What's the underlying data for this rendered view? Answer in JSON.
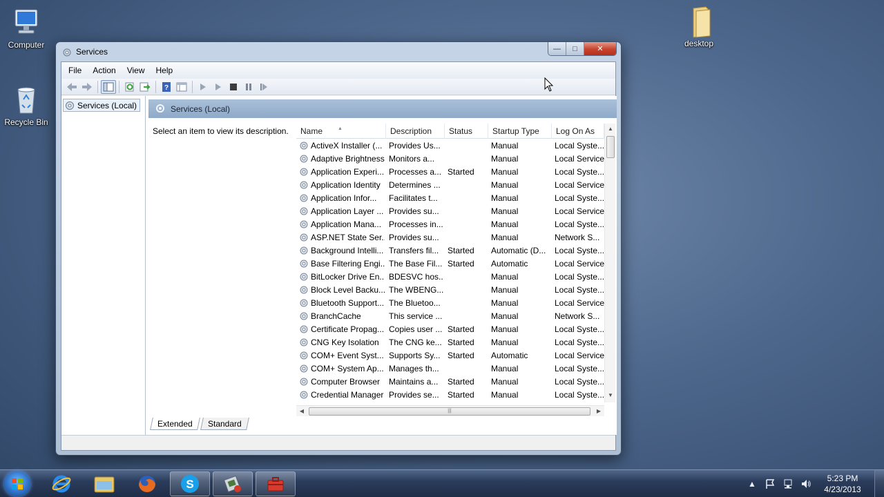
{
  "desktop": {
    "icons": [
      {
        "label": "Computer"
      },
      {
        "label": "Recycle Bin"
      },
      {
        "label": "desktop"
      }
    ]
  },
  "window": {
    "title": "Services",
    "controls": {
      "minimize": "—",
      "maximize": "□",
      "close": "✕"
    }
  },
  "menubar": [
    "File",
    "Action",
    "View",
    "Help"
  ],
  "toolbar": {
    "buttons": [
      "back",
      "forward",
      "show-hide-console-tree",
      "refresh",
      "export-list",
      "help",
      "properties",
      "start",
      "start-alt",
      "stop",
      "pause",
      "restart"
    ]
  },
  "tree": {
    "selected_label": "Services (Local)"
  },
  "panel": {
    "header": "Services (Local)",
    "description_prompt": "Select an item to view its description."
  },
  "list": {
    "columns": [
      "Name",
      "Description",
      "Status",
      "Startup Type",
      "Log On As"
    ],
    "sorted_by": "Name",
    "rows": [
      [
        "ActiveX Installer (...",
        "Provides Us...",
        "",
        "Manual",
        "Local Syste..."
      ],
      [
        "Adaptive Brightness",
        "Monitors a...",
        "",
        "Manual",
        "Local Service"
      ],
      [
        "Application Experi...",
        "Processes a...",
        "Started",
        "Manual",
        "Local Syste..."
      ],
      [
        "Application Identity",
        "Determines ...",
        "",
        "Manual",
        "Local Service"
      ],
      [
        "Application Infor...",
        "Facilitates t...",
        "",
        "Manual",
        "Local Syste..."
      ],
      [
        "Application Layer ...",
        "Provides su...",
        "",
        "Manual",
        "Local Service"
      ],
      [
        "Application Mana...",
        "Processes in...",
        "",
        "Manual",
        "Local Syste..."
      ],
      [
        "ASP.NET State Ser...",
        "Provides su...",
        "",
        "Manual",
        "Network S..."
      ],
      [
        "Background Intelli...",
        "Transfers fil...",
        "Started",
        "Automatic (D...",
        "Local Syste..."
      ],
      [
        "Base Filtering Engi...",
        "The Base Fil...",
        "Started",
        "Automatic",
        "Local Service"
      ],
      [
        "BitLocker Drive En...",
        "BDESVC hos...",
        "",
        "Manual",
        "Local Syste..."
      ],
      [
        "Block Level Backu...",
        "The WBENG...",
        "",
        "Manual",
        "Local Syste..."
      ],
      [
        "Bluetooth Support...",
        "The Bluetoo...",
        "",
        "Manual",
        "Local Service"
      ],
      [
        "BranchCache",
        "This service ...",
        "",
        "Manual",
        "Network S..."
      ],
      [
        "Certificate Propag...",
        "Copies user ...",
        "Started",
        "Manual",
        "Local Syste..."
      ],
      [
        "CNG Key Isolation",
        "The CNG ke...",
        "Started",
        "Manual",
        "Local Syste..."
      ],
      [
        "COM+ Event Syst...",
        "Supports Sy...",
        "Started",
        "Automatic",
        "Local Service"
      ],
      [
        "COM+ System Ap...",
        "Manages th...",
        "",
        "Manual",
        "Local Syste..."
      ],
      [
        "Computer Browser",
        "Maintains a...",
        "Started",
        "Manual",
        "Local Syste..."
      ],
      [
        "Credential Manager",
        "Provides se...",
        "Started",
        "Manual",
        "Local Syste..."
      ]
    ]
  },
  "view_tabs": [
    "Extended",
    "Standard"
  ],
  "taskbar": {
    "pinned": [
      "start-orb",
      "internet-explorer",
      "windows-explorer",
      "firefox",
      "skype",
      "admin-tools",
      "services-toolbox"
    ],
    "clock_time": "5:23 PM",
    "clock_date": "4/23/2013"
  }
}
